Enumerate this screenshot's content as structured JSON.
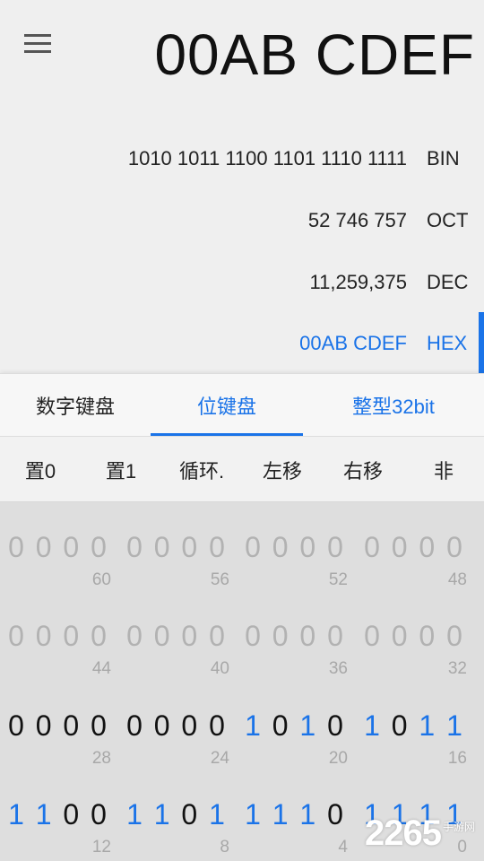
{
  "display": {
    "main_value": "00AB CDEF",
    "rows": [
      {
        "value": "1010 1011 1100 1101 1110 1111",
        "base": "BIN"
      },
      {
        "value": "52 746 757",
        "base": "OCT"
      },
      {
        "value": "11,259,375",
        "base": "DEC"
      },
      {
        "value": "00AB CDEF",
        "base": "HEX"
      }
    ],
    "active_base": "HEX"
  },
  "tabs": [
    "数字键盘",
    "位键盘",
    "整型32bit"
  ],
  "active_tab": "位键盘",
  "operations": [
    "置0",
    "置1",
    "循环.",
    "左移",
    "右移",
    "非"
  ],
  "bit_groups": [
    {
      "bits": "0000",
      "label": "60",
      "dim": true
    },
    {
      "bits": "0000",
      "label": "56",
      "dim": true
    },
    {
      "bits": "0000",
      "label": "52",
      "dim": true
    },
    {
      "bits": "0000",
      "label": "48",
      "dim": true
    },
    {
      "bits": "0000",
      "label": "44",
      "dim": true
    },
    {
      "bits": "0000",
      "label": "40",
      "dim": true
    },
    {
      "bits": "0000",
      "label": "36",
      "dim": true
    },
    {
      "bits": "0000",
      "label": "32",
      "dim": true
    },
    {
      "bits": "0000",
      "label": "28",
      "dim": false
    },
    {
      "bits": "0000",
      "label": "24",
      "dim": false
    },
    {
      "bits": "1010",
      "label": "20",
      "dim": false
    },
    {
      "bits": "1011",
      "label": "16",
      "dim": false
    },
    {
      "bits": "1100",
      "label": "12",
      "dim": false
    },
    {
      "bits": "1101",
      "label": "8",
      "dim": false
    },
    {
      "bits": "1110",
      "label": "4",
      "dim": false
    },
    {
      "bits": "1111",
      "label": "0",
      "dim": false
    }
  ],
  "watermark": {
    "number": "2265",
    "suffix": "手游网"
  },
  "colors": {
    "accent": "#1a73e8",
    "text": "#111111",
    "dim": "#b2b2b2"
  }
}
